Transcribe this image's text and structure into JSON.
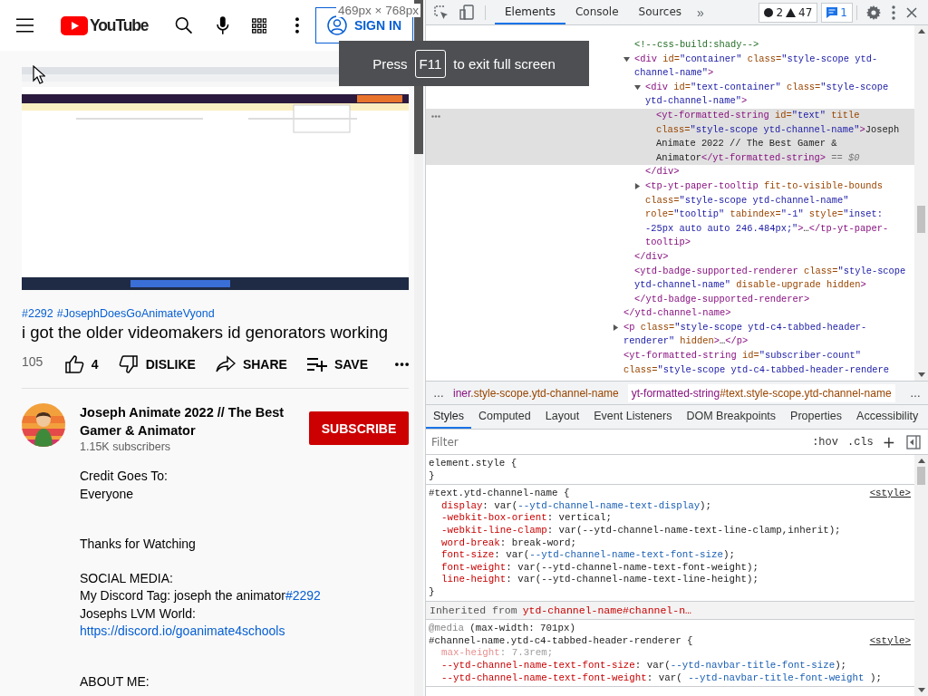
{
  "page": {
    "header": {
      "logo": "YouTube",
      "sign_in": "SIGN IN"
    },
    "hashtags": [
      "#2292",
      "#JosephDoesGoAnimateVyond"
    ],
    "title": "i got the older videomakers id genorators working",
    "views": "105",
    "actions": [
      {
        "kind": "like",
        "label": "4"
      },
      {
        "kind": "dislike",
        "label": "DISLIKE"
      },
      {
        "kind": "share",
        "label": "SHARE"
      },
      {
        "kind": "save",
        "label": "SAVE"
      }
    ],
    "channel": {
      "name": "Joseph Animate 2022 // The Best Gamer & Animator",
      "subscribers": "1.15K subscribers",
      "subscribe": "SUBSCRIBE"
    },
    "description": [
      {
        "kind": "first",
        "lines": [
          {
            "text": "Credit Goes To:"
          },
          {
            "text": "Everyone"
          }
        ]
      },
      {
        "kind": "wide",
        "lines": [
          {
            "text": "Thanks for Watching"
          }
        ]
      },
      {
        "kind": "spaced",
        "lines": [
          {
            "text": "SOCIAL MEDIA:"
          },
          {
            "text": "My Discord Tag: joseph the animator",
            "link": "#2292"
          },
          {
            "text": "Josephs LVM World:"
          },
          {
            "link": "https://discord.io/goanimate4schools"
          }
        ]
      },
      {
        "kind": "wide",
        "lines": [
          {
            "text": "ABOUT ME:"
          }
        ]
      }
    ]
  },
  "overlays": {
    "viewport_size": "469px × 768px",
    "fullscreen_notice": {
      "before": "Press",
      "key": "F11",
      "after": "to exit full screen"
    }
  },
  "devtools": {
    "tabs": [
      {
        "label": "Elements",
        "selected": true
      },
      {
        "label": "Console",
        "selected": false
      },
      {
        "label": "Sources",
        "selected": false
      }
    ],
    "more_tabs": "»",
    "errors": "2",
    "warnings": "47",
    "messages": "1",
    "dom_tree": [
      {
        "selected": false,
        "children": [
          {
            "selected": false,
            "open": [
              {
                "kind": "comment",
                "text": "<!--css-build:shady-->"
              }
            ]
          },
          {
            "selected": false,
            "expanded": true,
            "open": [
              {
                "kind": "tag",
                "text": "<div"
              },
              {
                "kind": "attr",
                "text": " id="
              },
              {
                "kind": "val",
                "text": "\"container\""
              },
              {
                "kind": "attr",
                "text": " class="
              },
              {
                "kind": "val",
                "text": "\"style-scope ytd-channel-name\""
              },
              {
                "kind": "tag",
                "text": ">"
              }
            ],
            "children": [
              {
                "selected": false,
                "expanded": true,
                "open": [
                  {
                    "kind": "tag",
                    "text": "<div"
                  },
                  {
                    "kind": "attr",
                    "text": " id="
                  },
                  {
                    "kind": "val",
                    "text": "\"text-container\""
                  },
                  {
                    "kind": "attr",
                    "text": " class="
                  },
                  {
                    "kind": "val",
                    "text": "\"style-scope ytd-channel-name\""
                  },
                  {
                    "kind": "tag",
                    "text": ">"
                  }
                ],
                "children": [
                  {
                    "selected": true,
                    "open": [
                      {
                        "kind": "tag",
                        "text": "<yt-formatted-string"
                      },
                      {
                        "kind": "attr",
                        "text": " id="
                      },
                      {
                        "kind": "val",
                        "text": "\"text\""
                      },
                      {
                        "kind": "attr",
                        "text": " title"
                      },
                      {
                        "kind": "attr",
                        "text": " class="
                      },
                      {
                        "kind": "val",
                        "text": "\"style-scope ytd-channel-name\""
                      },
                      {
                        "kind": "tag",
                        "text": ">"
                      },
                      {
                        "kind": "text",
                        "text": "Joseph Animate 2022 // The Best Gamer & Animator"
                      },
                      {
                        "kind": "tag",
                        "text": "</yt-formatted-string>"
                      },
                      {
                        "kind": "hint",
                        "text": " == $0"
                      }
                    ]
                  }
                ],
                "close": [
                  {
                    "kind": "tag",
                    "text": "</div>"
                  }
                ]
              },
              {
                "selected": false,
                "expanded": false,
                "open": [
                  {
                    "kind": "tag",
                    "text": "<tp-yt-paper-tooltip"
                  },
                  {
                    "kind": "attr",
                    "text": " fit-to-visible-bounds"
                  },
                  {
                    "kind": "attr",
                    "text": " class="
                  },
                  {
                    "kind": "val",
                    "text": "\"style-scope ytd-channel-name\""
                  },
                  {
                    "kind": "attr",
                    "text": " role="
                  },
                  {
                    "kind": "val",
                    "text": "\"tooltip\""
                  },
                  {
                    "kind": "attr",
                    "text": " tabindex="
                  },
                  {
                    "kind": "val",
                    "text": "\"-1\""
                  },
                  {
                    "kind": "attr",
                    "text": " style="
                  },
                  {
                    "kind": "val",
                    "text": "\"inset: -25px auto auto 246.484px;\""
                  },
                  {
                    "kind": "tag",
                    "text": ">"
                  },
                  {
                    "kind": "text",
                    "text": "…"
                  },
                  {
                    "kind": "tag",
                    "text": "</tp-yt-paper-tooltip>"
                  }
                ]
              }
            ],
            "close": [
              {
                "kind": "tag",
                "text": "</div>"
              }
            ]
          },
          {
            "selected": false,
            "open": [
              {
                "kind": "tag",
                "text": "<ytd-badge-supported-renderer"
              },
              {
                "kind": "attr",
                "text": " class="
              },
              {
                "kind": "val",
                "text": "\"style-scope ytd-channel-name\""
              },
              {
                "kind": "attr",
                "text": " disable-upgrade"
              },
              {
                "kind": "attr",
                "text": " hidden"
              },
              {
                "kind": "tag",
                "text": ">"
              }
            ],
            "close": [
              {
                "kind": "tag",
                "text": "</ytd-badge-supported-renderer>"
              }
            ]
          }
        ],
        "close": [
          {
            "kind": "tag",
            "text": "</ytd-channel-name>"
          }
        ]
      },
      {
        "selected": false,
        "expanded": false,
        "open": [
          {
            "kind": "tag",
            "text": "<p"
          },
          {
            "kind": "attr",
            "text": " class="
          },
          {
            "kind": "val",
            "text": "\"style-scope ytd-c4-tabbed-header-renderer\""
          },
          {
            "kind": "attr",
            "text": " hidden"
          },
          {
            "kind": "tag",
            "text": ">"
          },
          {
            "kind": "text",
            "text": "…"
          },
          {
            "kind": "tag",
            "text": "</p>"
          }
        ]
      },
      {
        "selected": false,
        "open": [
          {
            "kind": "tag",
            "text": "<yt-formatted-string"
          },
          {
            "kind": "attr",
            "text": " id="
          },
          {
            "kind": "val",
            "text": "\"subscriber-count\""
          },
          {
            "kind": "attr",
            "text": " class="
          },
          {
            "kind": "val",
            "text": "\"style-scope ytd-c4-tabbed-header-rendere"
          }
        ]
      }
    ],
    "breadcrumbs": {
      "left": "…",
      "right": "…",
      "items": [
        {
          "tag": "iner",
          "rest": ".style-scope.ytd-channel-name",
          "selected": false
        },
        {
          "tag": "yt-formatted-string",
          "rest": "#text.style-scope.ytd-channel-name",
          "selected": true
        }
      ]
    },
    "styles_tabs": [
      {
        "label": "Styles",
        "selected": true
      },
      {
        "label": "Computed",
        "selected": false
      },
      {
        "label": "Layout",
        "selected": false
      },
      {
        "label": "Event Listeners",
        "selected": false
      },
      {
        "label": "DOM Breakpoints",
        "selected": false
      },
      {
        "label": "Properties",
        "selected": false
      },
      {
        "label": "Accessibility",
        "selected": false
      }
    ],
    "filter_placeholder": "Filter",
    "hov": ":hov",
    "cls": ".cls",
    "new_rule": "+",
    "rules": [
      {
        "kind": "rule",
        "selector": "element.style",
        "brace": "{",
        "end": "}"
      },
      {
        "kind": "rule",
        "selector": "#text.ytd-channel-name",
        "brace": "{",
        "end": "}",
        "source": "<style>",
        "declarations": [
          {
            "prop": "display",
            "rest": ": var(",
            "var": "--ytd-channel-name-text-display",
            "end": ");",
            "overridden": false
          },
          {
            "prop": "-webkit-box-orient",
            "rest": ": vertical;",
            "overridden": false
          },
          {
            "prop": "-webkit-line-clamp",
            "rest": ": var(--ytd-channel-name-text-line-clamp,inherit);",
            "overridden": false
          },
          {
            "prop": "word-break",
            "rest": ": break-word;",
            "overridden": false
          },
          {
            "prop": "font-size",
            "rest": ": var(",
            "var": "--ytd-channel-name-text-font-size",
            "end": ");",
            "overridden": false
          },
          {
            "prop": "font-weight",
            "rest": ": var(--ytd-channel-name-text-font-weight);",
            "overridden": false
          },
          {
            "prop": "line-height",
            "rest": ": var(--ytd-channel-name-text-line-height);",
            "overridden": false
          }
        ]
      },
      {
        "kind": "inherited",
        "label": "Inherited from",
        "selector": "ytd-channel-name#channel-n…"
      },
      {
        "kind": "rule",
        "media_keyword": "@media",
        "media": " (max-width: 701px)",
        "selector": "#channel-name.ytd-c4-tabbed-header-renderer",
        "brace": "{",
        "source": "<style>",
        "declarations": [
          {
            "prop": "max-height",
            "rest": ": 7.3rem;",
            "overridden": true
          },
          {
            "prop": "--ytd-channel-name-text-font-size",
            "rest": ": var(",
            "var": "--ytd-navbar-title-font-size",
            "end": ");",
            "overridden": false
          },
          {
            "prop": "--ytd-channel-name-text-font-weight",
            "rest": ": var( ",
            "var": "--ytd-navbar-title-font-weight",
            "end": " );",
            "overridden": false
          }
        ]
      }
    ]
  }
}
